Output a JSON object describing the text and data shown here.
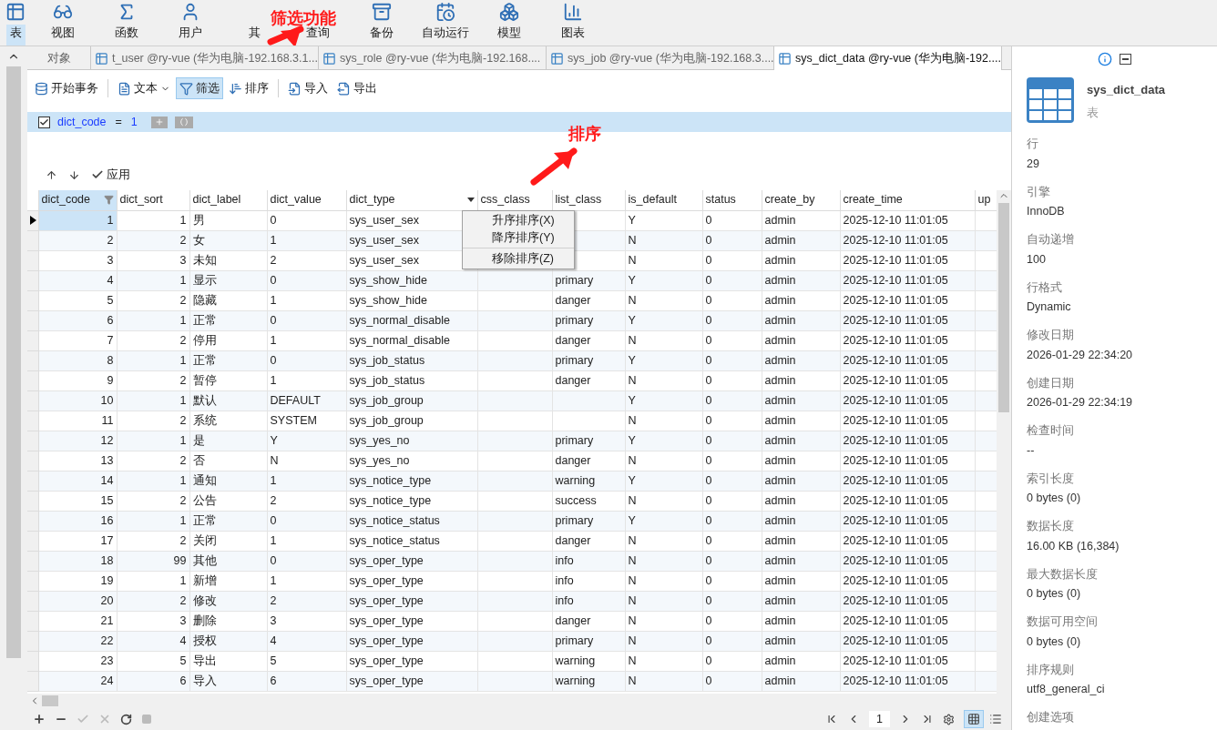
{
  "ribbon": [
    {
      "label": "表",
      "kind": "table",
      "selected": true
    },
    {
      "label": "视图",
      "kind": "view",
      "selected": false
    },
    {
      "label": "函数",
      "kind": "function",
      "selected": false
    },
    {
      "label": "用户",
      "kind": "user",
      "selected": false
    },
    {
      "label": "其",
      "kind": "other",
      "selected": false
    },
    {
      "label": "查询",
      "kind": "query",
      "selected": false
    },
    {
      "label": "备份",
      "kind": "backup",
      "selected": false
    },
    {
      "label": "自动运行",
      "kind": "schedule",
      "selected": false
    },
    {
      "label": "模型",
      "kind": "model",
      "selected": false
    },
    {
      "label": "图表",
      "kind": "chart",
      "selected": false
    }
  ],
  "annotations": [
    {
      "text": "筛选功能"
    },
    {
      "text": "排序"
    }
  ],
  "tabs": [
    {
      "label": "对象",
      "kind": "objects",
      "selected": false
    },
    {
      "label": "t_user @ry-vue (华为电脑-192.168.3.1...",
      "kind": "table",
      "selected": false
    },
    {
      "label": "sys_role @ry-vue (华为电脑-192.168....",
      "kind": "table",
      "selected": false
    },
    {
      "label": "sys_job @ry-vue (华为电脑-192.168.3....",
      "kind": "table",
      "selected": false
    },
    {
      "label": "sys_dict_data @ry-vue (华为电脑-192....",
      "kind": "table",
      "selected": true
    }
  ],
  "toolbar": [
    {
      "label": "开始事务",
      "kind": "transaction",
      "selected": false,
      "menu": false
    },
    {
      "label": "文本",
      "kind": "text",
      "selected": false,
      "menu": true
    },
    {
      "label": "筛选",
      "kind": "filter",
      "selected": true,
      "menu": false
    },
    {
      "label": "排序",
      "kind": "sort",
      "selected": false,
      "menu": false
    },
    {
      "label": "导入",
      "kind": "import",
      "selected": false,
      "menu": false
    },
    {
      "label": "导出",
      "kind": "export",
      "selected": false,
      "menu": false
    }
  ],
  "filter": {
    "checked": true,
    "field": "dict_code",
    "operator": "=",
    "value": "1"
  },
  "filter_actions": {
    "apply": "应用"
  },
  "table": {
    "columns": [
      {
        "label": "dict_code",
        "filtered": true,
        "menu": false
      },
      {
        "label": "dict_sort",
        "filtered": false,
        "menu": false
      },
      {
        "label": "dict_label",
        "filtered": false,
        "menu": false
      },
      {
        "label": "dict_value",
        "filtered": false,
        "menu": false
      },
      {
        "label": "dict_type",
        "filtered": false,
        "menu": true
      },
      {
        "label": "css_class",
        "filtered": false,
        "menu": false
      },
      {
        "label": "list_class",
        "filtered": false,
        "menu": false
      },
      {
        "label": "is_default",
        "filtered": false,
        "menu": false
      },
      {
        "label": "status",
        "filtered": false,
        "menu": false
      },
      {
        "label": "create_by",
        "filtered": false,
        "menu": false
      },
      {
        "label": "create_time",
        "filtered": false,
        "menu": false
      },
      {
        "label": "up",
        "filtered": false,
        "menu": false
      }
    ],
    "rows": [
      {
        "selected": true,
        "cells": [
          "1",
          "1",
          "男",
          "0",
          "sys_user_sex",
          null,
          null,
          "Y",
          "0",
          "admin",
          "2025-12-10 11:01:05"
        ]
      },
      {
        "selected": false,
        "cells": [
          "2",
          "2",
          "女",
          "1",
          "sys_user_sex",
          null,
          null,
          "N",
          "0",
          "admin",
          "2025-12-10 11:01:05"
        ]
      },
      {
        "selected": false,
        "cells": [
          "3",
          "3",
          "未知",
          "2",
          "sys_user_sex",
          null,
          null,
          "N",
          "0",
          "admin",
          "2025-12-10 11:01:05"
        ]
      },
      {
        "selected": false,
        "cells": [
          "4",
          "1",
          "显示",
          "0",
          "sys_show_hide",
          null,
          "primary",
          "Y",
          "0",
          "admin",
          "2025-12-10 11:01:05"
        ]
      },
      {
        "selected": false,
        "cells": [
          "5",
          "2",
          "隐藏",
          "1",
          "sys_show_hide",
          null,
          "danger",
          "N",
          "0",
          "admin",
          "2025-12-10 11:01:05"
        ]
      },
      {
        "selected": false,
        "cells": [
          "6",
          "1",
          "正常",
          "0",
          "sys_normal_disable",
          null,
          "primary",
          "Y",
          "0",
          "admin",
          "2025-12-10 11:01:05"
        ]
      },
      {
        "selected": false,
        "cells": [
          "7",
          "2",
          "停用",
          "1",
          "sys_normal_disable",
          null,
          "danger",
          "N",
          "0",
          "admin",
          "2025-12-10 11:01:05"
        ]
      },
      {
        "selected": false,
        "cells": [
          "8",
          "1",
          "正常",
          "0",
          "sys_job_status",
          null,
          "primary",
          "Y",
          "0",
          "admin",
          "2025-12-10 11:01:05"
        ]
      },
      {
        "selected": false,
        "cells": [
          "9",
          "2",
          "暂停",
          "1",
          "sys_job_status",
          null,
          "danger",
          "N",
          "0",
          "admin",
          "2025-12-10 11:01:05"
        ]
      },
      {
        "selected": false,
        "cells": [
          "10",
          "1",
          "默认",
          "DEFAULT",
          "sys_job_group",
          null,
          null,
          "Y",
          "0",
          "admin",
          "2025-12-10 11:01:05"
        ]
      },
      {
        "selected": false,
        "cells": [
          "11",
          "2",
          "系统",
          "SYSTEM",
          "sys_job_group",
          null,
          null,
          "N",
          "0",
          "admin",
          "2025-12-10 11:01:05"
        ]
      },
      {
        "selected": false,
        "cells": [
          "12",
          "1",
          "是",
          "Y",
          "sys_yes_no",
          null,
          "primary",
          "Y",
          "0",
          "admin",
          "2025-12-10 11:01:05"
        ]
      },
      {
        "selected": false,
        "cells": [
          "13",
          "2",
          "否",
          "N",
          "sys_yes_no",
          null,
          "danger",
          "N",
          "0",
          "admin",
          "2025-12-10 11:01:05"
        ]
      },
      {
        "selected": false,
        "cells": [
          "14",
          "1",
          "通知",
          "1",
          "sys_notice_type",
          null,
          "warning",
          "Y",
          "0",
          "admin",
          "2025-12-10 11:01:05"
        ]
      },
      {
        "selected": false,
        "cells": [
          "15",
          "2",
          "公告",
          "2",
          "sys_notice_type",
          null,
          "success",
          "N",
          "0",
          "admin",
          "2025-12-10 11:01:05"
        ]
      },
      {
        "selected": false,
        "cells": [
          "16",
          "1",
          "正常",
          "0",
          "sys_notice_status",
          null,
          "primary",
          "Y",
          "0",
          "admin",
          "2025-12-10 11:01:05"
        ]
      },
      {
        "selected": false,
        "cells": [
          "17",
          "2",
          "关闭",
          "1",
          "sys_notice_status",
          null,
          "danger",
          "N",
          "0",
          "admin",
          "2025-12-10 11:01:05"
        ]
      },
      {
        "selected": false,
        "cells": [
          "18",
          "99",
          "其他",
          "0",
          "sys_oper_type",
          null,
          "info",
          "N",
          "0",
          "admin",
          "2025-12-10 11:01:05"
        ]
      },
      {
        "selected": false,
        "cells": [
          "19",
          "1",
          "新增",
          "1",
          "sys_oper_type",
          null,
          "info",
          "N",
          "0",
          "admin",
          "2025-12-10 11:01:05"
        ]
      },
      {
        "selected": false,
        "cells": [
          "20",
          "2",
          "修改",
          "2",
          "sys_oper_type",
          null,
          "info",
          "N",
          "0",
          "admin",
          "2025-12-10 11:01:05"
        ]
      },
      {
        "selected": false,
        "cells": [
          "21",
          "3",
          "删除",
          "3",
          "sys_oper_type",
          null,
          "danger",
          "N",
          "0",
          "admin",
          "2025-12-10 11:01:05"
        ]
      },
      {
        "selected": false,
        "cells": [
          "22",
          "4",
          "授权",
          "4",
          "sys_oper_type",
          null,
          "primary",
          "N",
          "0",
          "admin",
          "2025-12-10 11:01:05"
        ]
      },
      {
        "selected": false,
        "cells": [
          "23",
          "5",
          "导出",
          "5",
          "sys_oper_type",
          null,
          "warning",
          "N",
          "0",
          "admin",
          "2025-12-10 11:01:05"
        ]
      },
      {
        "selected": false,
        "cells": [
          "24",
          "6",
          "导入",
          "6",
          "sys_oper_type",
          null,
          "warning",
          "N",
          "0",
          "admin",
          "2025-12-10 11:01:05"
        ]
      }
    ]
  },
  "context_menu": {
    "items": [
      {
        "label": "升序排序(X)",
        "separator_before": false
      },
      {
        "label": "降序排序(Y)",
        "separator_before": false
      },
      {
        "label": "移除排序(Z)",
        "separator_before": true
      }
    ]
  },
  "pager": {
    "page": "1"
  },
  "view_modes": [
    {
      "kind": "grid",
      "selected": true
    },
    {
      "kind": "form",
      "selected": false
    }
  ],
  "info_panel": {
    "name": "sys_dict_data",
    "type": "表",
    "properties": [
      {
        "label": "行",
        "value": "29"
      },
      {
        "label": "引擎",
        "value": "InnoDB"
      },
      {
        "label": "自动递增",
        "value": "100"
      },
      {
        "label": "行格式",
        "value": "Dynamic"
      },
      {
        "label": "修改日期",
        "value": "2026-01-29 22:34:20"
      },
      {
        "label": "创建日期",
        "value": "2026-01-29 22:34:19"
      },
      {
        "label": "检查时间",
        "value": "--"
      },
      {
        "label": "索引长度",
        "value": "0 bytes (0)"
      },
      {
        "label": "数据长度",
        "value": "16.00 KB (16,384)"
      },
      {
        "label": "最大数据长度",
        "value": "0 bytes (0)"
      },
      {
        "label": "数据可用空间",
        "value": "0 bytes (0)"
      },
      {
        "label": "排序规则",
        "value": "utf8_general_ci"
      },
      {
        "label": "创建选项"
      }
    ]
  }
}
